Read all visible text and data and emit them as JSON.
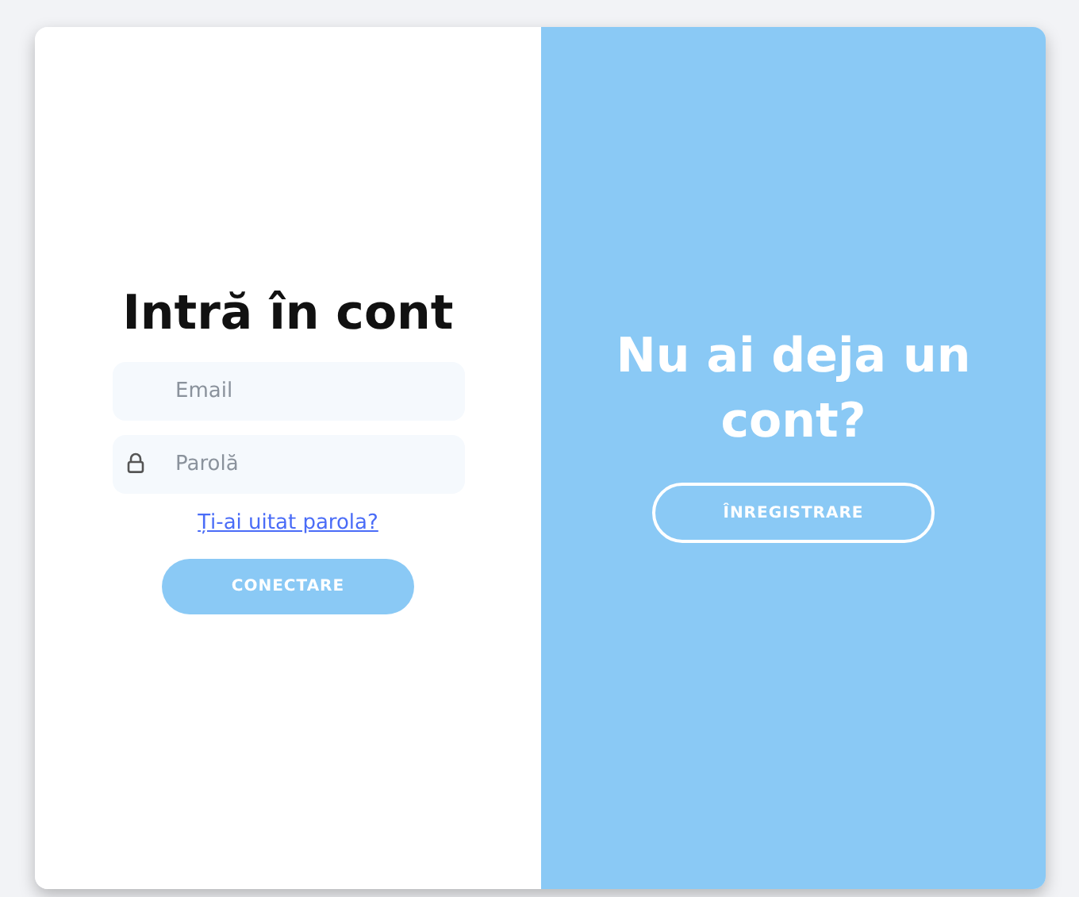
{
  "login": {
    "title": "Intră în cont",
    "fields": [
      {
        "kind": "email",
        "placeholder": "Email"
      },
      {
        "kind": "password",
        "placeholder": "Parolă"
      }
    ],
    "forgot_link": "Ți-ai uitat parola?",
    "submit": "CONECTARE"
  },
  "signup": {
    "title": "Nu ai deja un cont?",
    "button": "ÎNREGISTRARE"
  }
}
